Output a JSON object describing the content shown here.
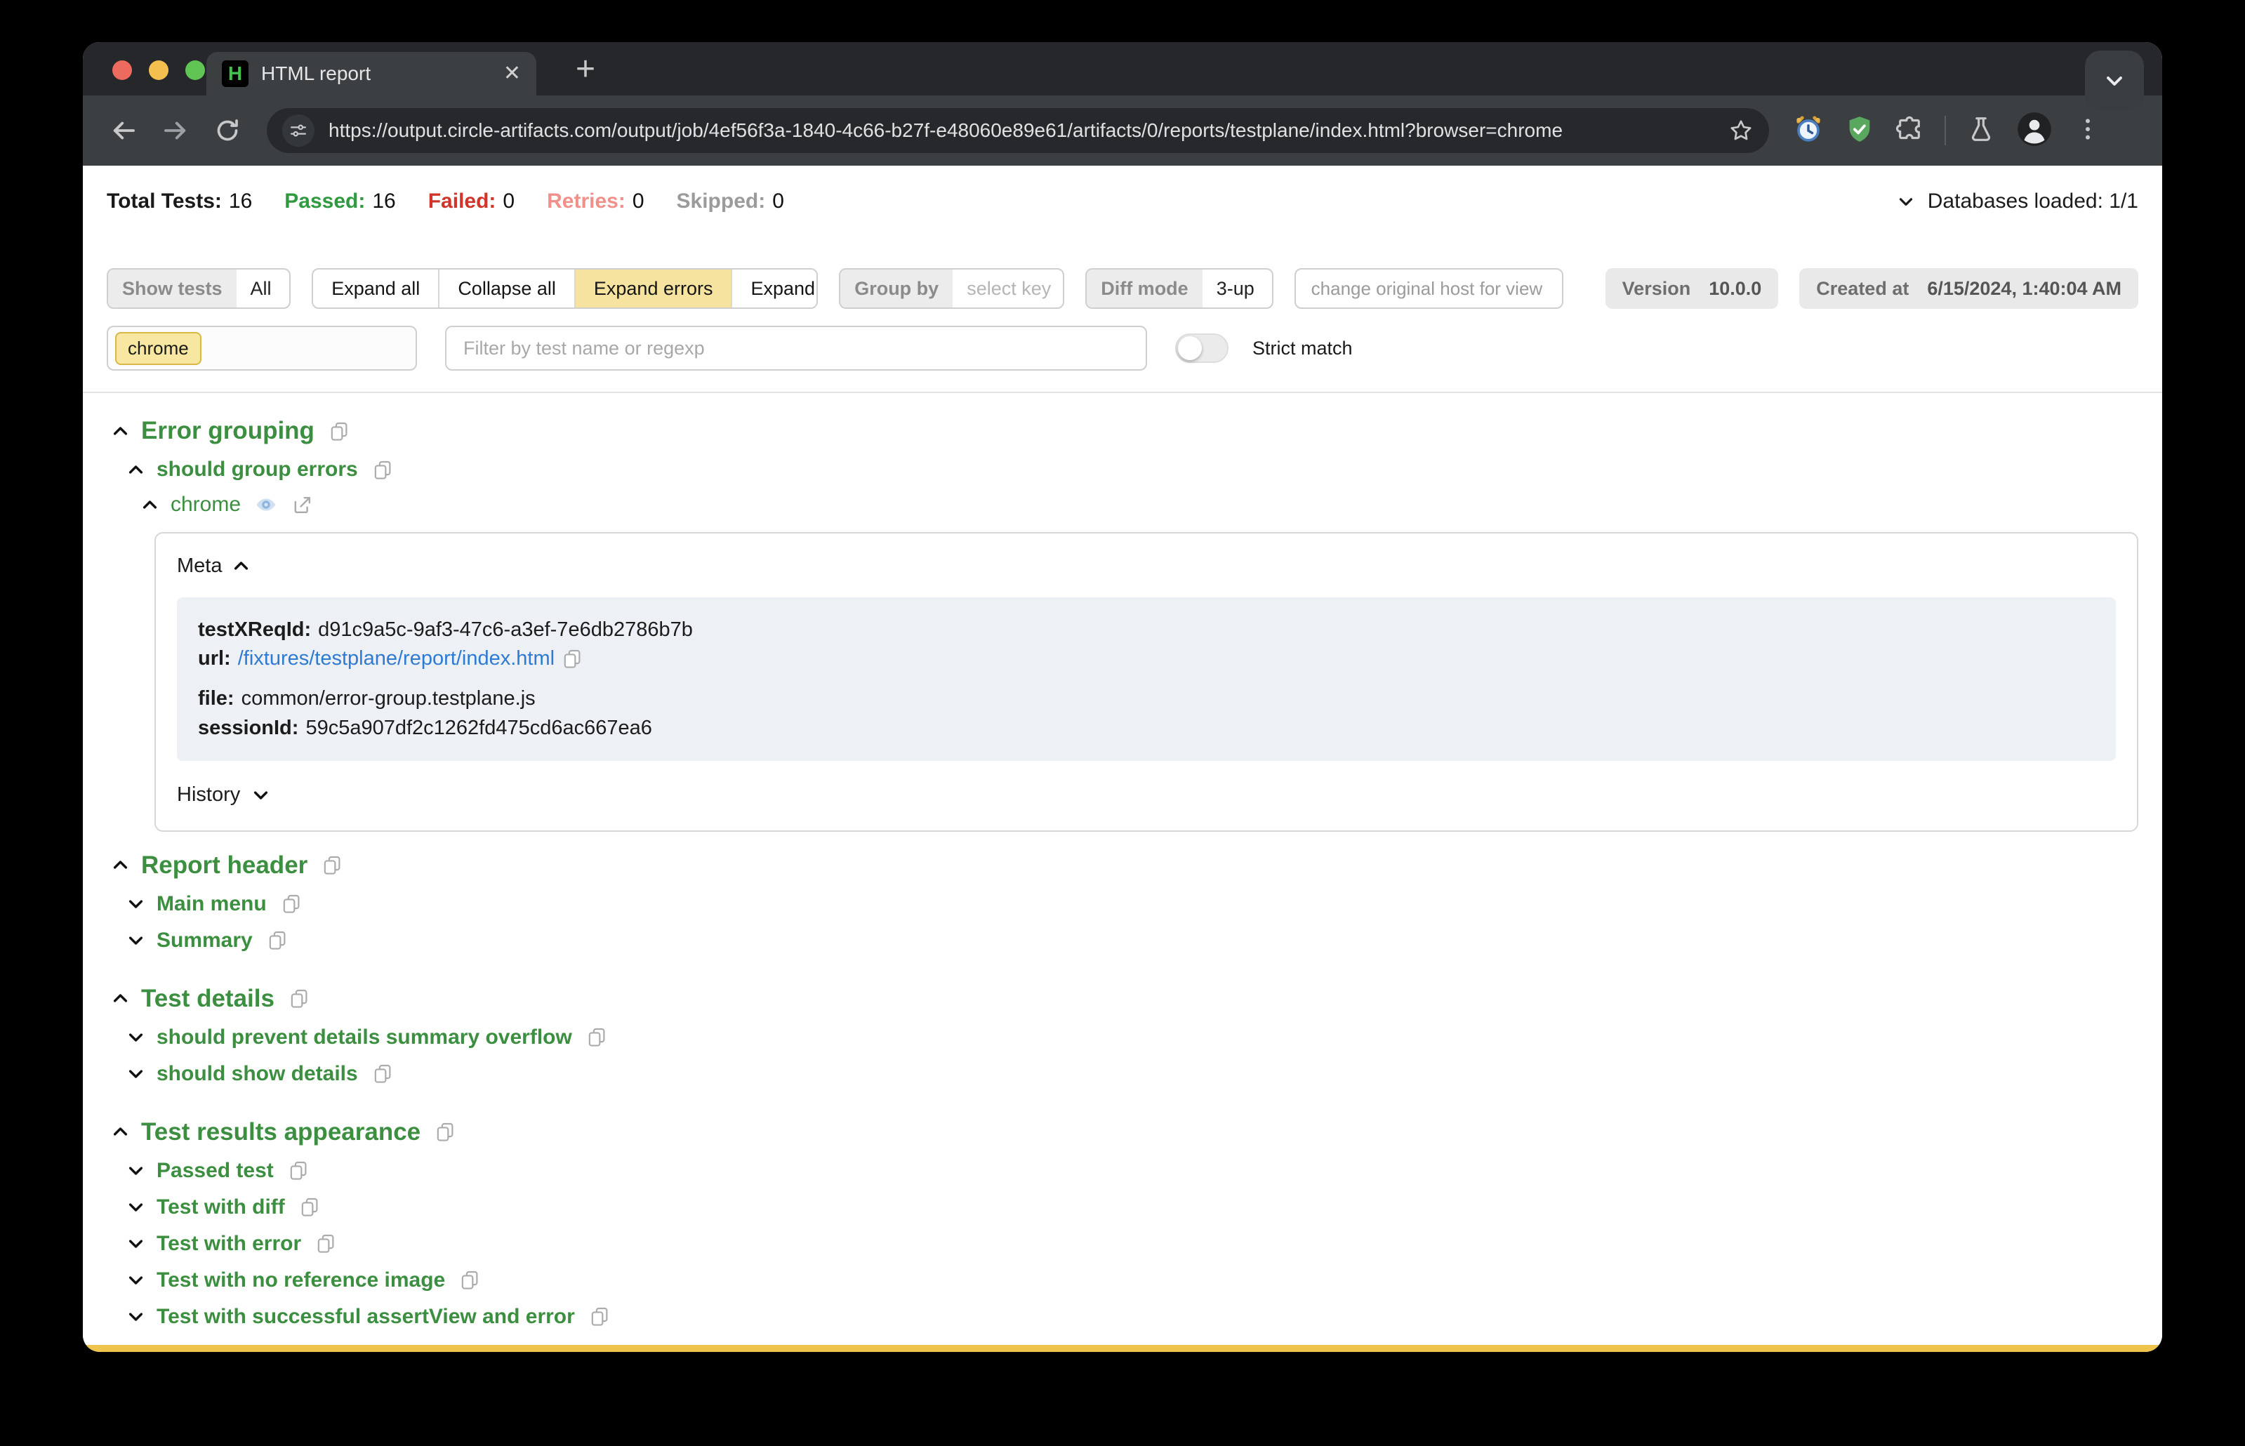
{
  "colors": {
    "accent_green": "#3c8e40",
    "highlight_yellow": "#f6e3a0",
    "chip_yellow": "#f8e7a0",
    "link_blue": "#2e7bd1",
    "passed_green": "#2f9a3f",
    "failed_red": "#d0342a",
    "retries_pink": "#f0908a",
    "skipped_gray": "#9b9b9b",
    "bottom_bar_yellow": "#eec44d"
  },
  "browser": {
    "tab_title": "HTML report",
    "favicon_letter": "H",
    "url": "https://output.circle-artifacts.com/output/job/4ef56f3a-1840-4c66-b27f-e48060e89e61/artifacts/0/reports/testplane/index.html?browser=chrome",
    "new_tab_icon": "+",
    "close_tab_icon": "✕",
    "back_icon": "←",
    "forward_icon": "→",
    "kebab_icon": "⋮"
  },
  "stats": {
    "items": [
      {
        "label": "Total Tests:",
        "value": "16",
        "color": "#1a1a1a"
      },
      {
        "label": "Passed:",
        "value": "16",
        "color": "#2f9a3f"
      },
      {
        "label": "Failed:",
        "value": "0",
        "color": "#d0342a"
      },
      {
        "label": "Retries:",
        "value": "0",
        "color": "#f0908a"
      },
      {
        "label": "Skipped:",
        "value": "0",
        "color": "#9b9b9b"
      }
    ],
    "databases_loaded_label": "Databases loaded: 1/1"
  },
  "controls": {
    "show_tests_label": "Show tests",
    "show_tests_value": "All",
    "buttons": [
      "Expand all",
      "Collapse all",
      "Expand errors",
      "Expand retries"
    ],
    "active_button": "Expand errors",
    "group_by_label": "Group by",
    "group_by_placeholder": "select key",
    "diff_mode_label": "Diff mode",
    "diff_mode_value": "3-up",
    "host_placeholder": "change original host for view in browse",
    "version_label": "Version",
    "version_value": "10.0.0",
    "created_label": "Created at",
    "created_value": "6/15/2024, 1:40:04 AM"
  },
  "filters": {
    "browser_chip": "chrome",
    "name_filter_placeholder": "Filter by test name or regexp",
    "strict_match_label": "Strict match"
  },
  "tree": {
    "rows_before_card": [
      {
        "text": "Error grouping",
        "level": 0,
        "style": "h1",
        "chevron": "up",
        "icons": [
          "copy"
        ]
      },
      {
        "text": "should group errors",
        "level": 1,
        "style": "h2",
        "chevron": "up",
        "icons": [
          "copy"
        ]
      },
      {
        "text": "chrome",
        "level": 2,
        "style": "browser",
        "chevron": "up",
        "icons": [
          "eye",
          "share"
        ]
      }
    ],
    "rows_after_card": [
      {
        "text": "Report header",
        "level": 0,
        "style": "h1",
        "chevron": "up",
        "icons": [
          "copy"
        ]
      },
      {
        "text": "Main menu",
        "level": 1,
        "style": "h2",
        "chevron": "down",
        "icons": [
          "copy"
        ]
      },
      {
        "text": "Summary",
        "level": 1,
        "style": "h2",
        "chevron": "down",
        "icons": [
          "copy"
        ]
      },
      {
        "text": "Test details",
        "level": 0,
        "style": "h1",
        "chevron": "up",
        "icons": [
          "copy"
        ]
      },
      {
        "text": "should prevent details summary overflow",
        "level": 1,
        "style": "h2",
        "chevron": "down",
        "icons": [
          "copy"
        ]
      },
      {
        "text": "should show details",
        "level": 1,
        "style": "h2",
        "chevron": "down",
        "icons": [
          "copy"
        ]
      },
      {
        "text": "Test results appearance",
        "level": 0,
        "style": "h1",
        "chevron": "up",
        "icons": [
          "copy"
        ]
      },
      {
        "text": "Passed test",
        "level": 1,
        "style": "h2",
        "chevron": "down",
        "icons": [
          "copy"
        ]
      },
      {
        "text": "Test with diff",
        "level": 1,
        "style": "h2",
        "chevron": "down",
        "icons": [
          "copy"
        ]
      },
      {
        "text": "Test with error",
        "level": 1,
        "style": "h2",
        "chevron": "down",
        "icons": [
          "copy"
        ]
      },
      {
        "text": "Test with no reference image",
        "level": 1,
        "style": "h2",
        "chevron": "down",
        "icons": [
          "copy"
        ]
      },
      {
        "text": "Test with successful assertView and error",
        "level": 1,
        "style": "h2",
        "chevron": "down",
        "icons": [
          "copy"
        ]
      }
    ]
  },
  "meta": {
    "title": "Meta",
    "rows": [
      {
        "label": "testXReqId:",
        "value": "d91c9a5c-9af3-47c6-a3ef-7e6db2786b7b"
      },
      {
        "label": "url:",
        "value": "/fixtures/testplane/report/index.html"
      },
      {
        "label": "file:",
        "value": "common/error-group.testplane.js"
      },
      {
        "label": "sessionId:",
        "value": "59c5a907df2c1262fd475cd6ac667ea6"
      }
    ],
    "history_label": "History"
  }
}
